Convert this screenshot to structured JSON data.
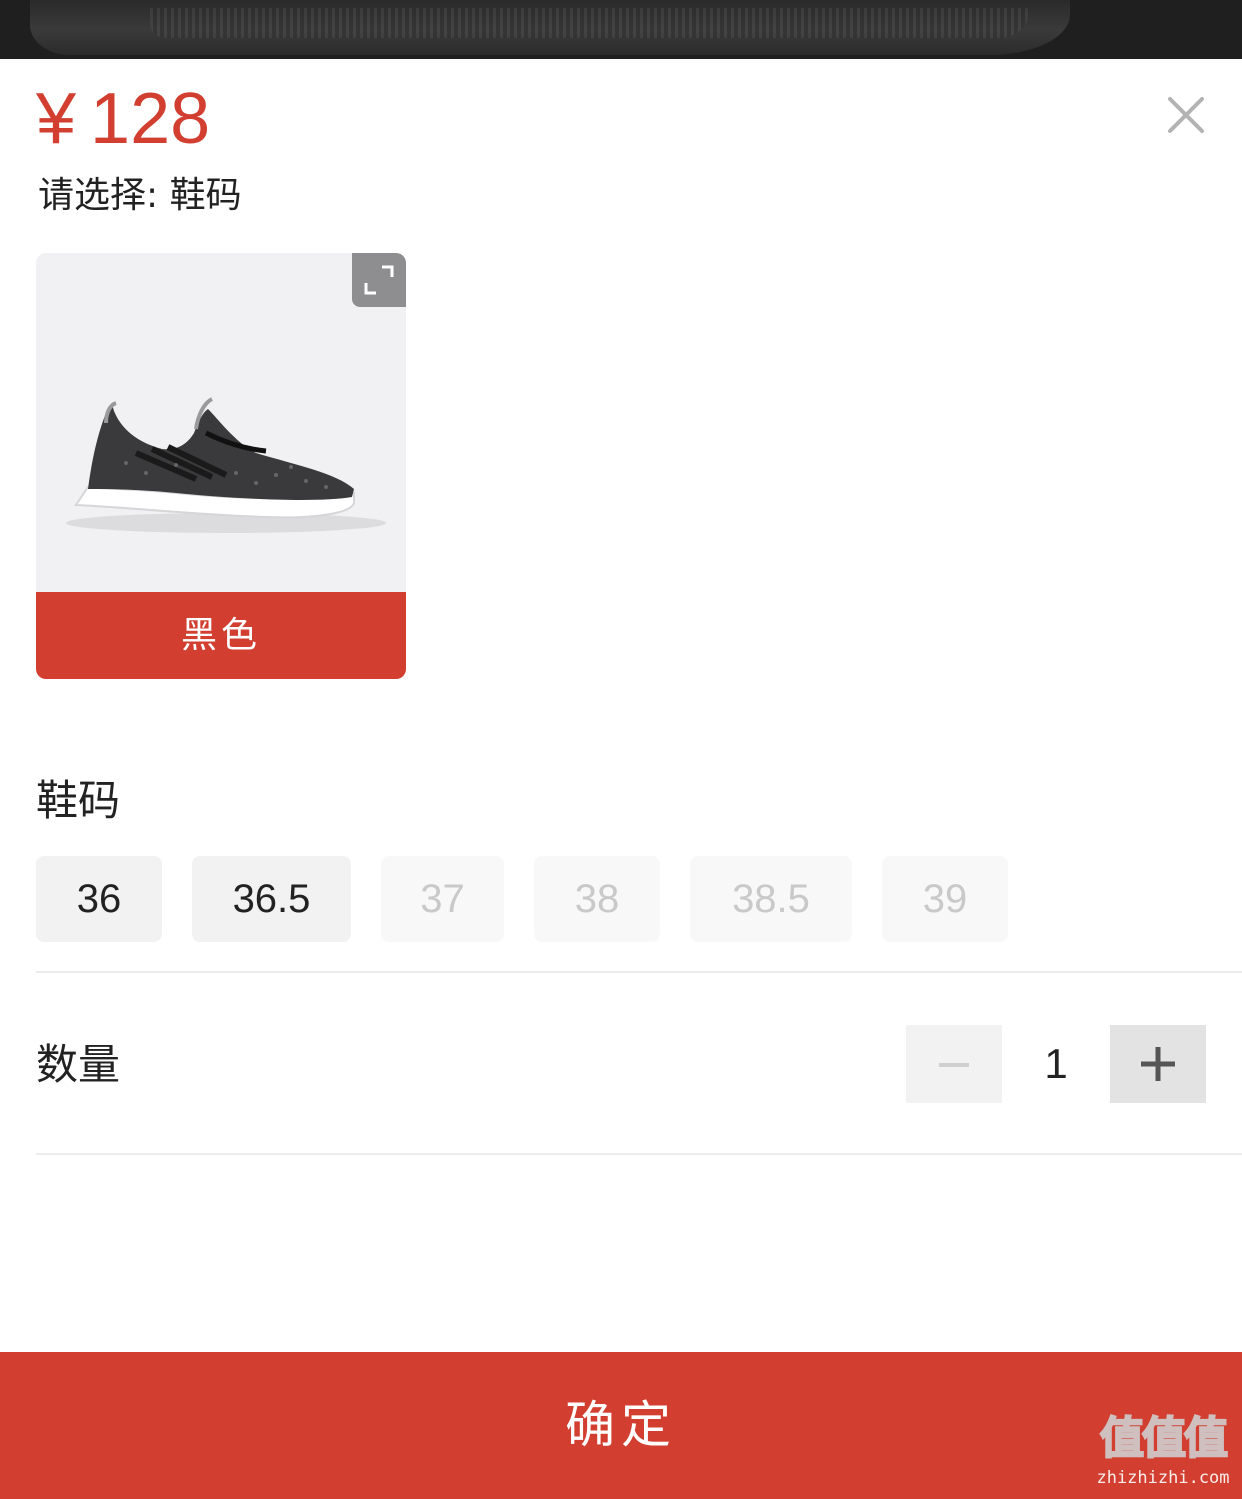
{
  "product": {
    "currency_symbol": "¥",
    "price": "128",
    "prompt": "请选择: 鞋码"
  },
  "variant": {
    "label": "黑色",
    "selected": true
  },
  "size_section": {
    "title": "鞋码",
    "sizes": [
      {
        "label": "36",
        "available": true
      },
      {
        "label": "36.5",
        "available": true
      },
      {
        "label": "37",
        "available": false
      },
      {
        "label": "38",
        "available": false
      },
      {
        "label": "38.5",
        "available": false
      },
      {
        "label": "39",
        "available": false
      }
    ]
  },
  "quantity": {
    "label": "数量",
    "value": "1"
  },
  "confirm_label": "确定",
  "watermark": {
    "big": "值值值",
    "small": "zhizhizhi.com"
  },
  "icons": {
    "close": "close-icon",
    "expand": "expand-icon",
    "minus": "minus-icon",
    "plus": "plus-icon"
  },
  "colors": {
    "accent": "#d23f31",
    "chip_available_bg": "#f2f2f2",
    "chip_unavailable_text": "#c9c9c9"
  }
}
